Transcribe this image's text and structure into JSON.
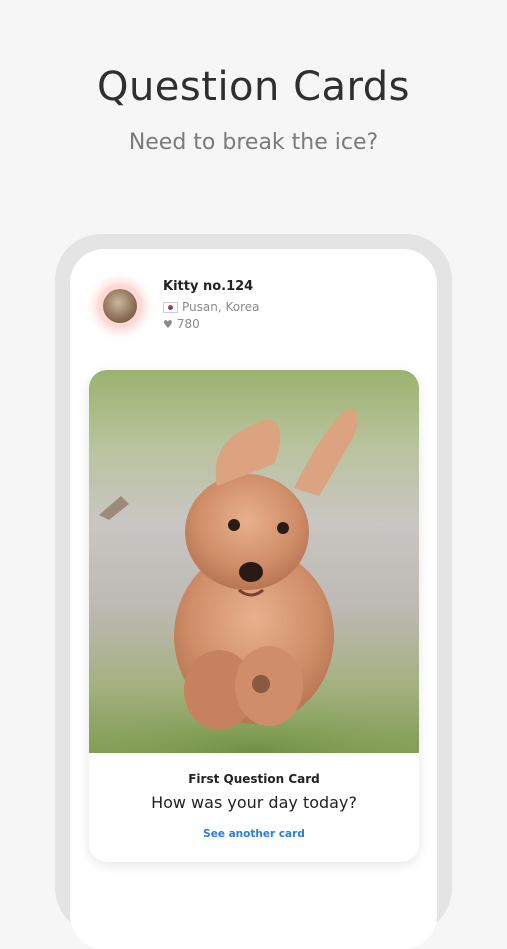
{
  "header": {
    "title": "Question Cards",
    "subtitle": "Need to break the ice?"
  },
  "profile": {
    "name": "Kitty no.124",
    "location": "Pusan, Korea",
    "likes": "780",
    "flag_icon": "korea-flag-icon",
    "heart_icon": "heart-icon"
  },
  "card": {
    "title": "First Question Card",
    "question": "How was your day today?",
    "link": "See another card"
  },
  "colors": {
    "accent": "#2a7de0",
    "avatar_glow": "#ff8278"
  }
}
